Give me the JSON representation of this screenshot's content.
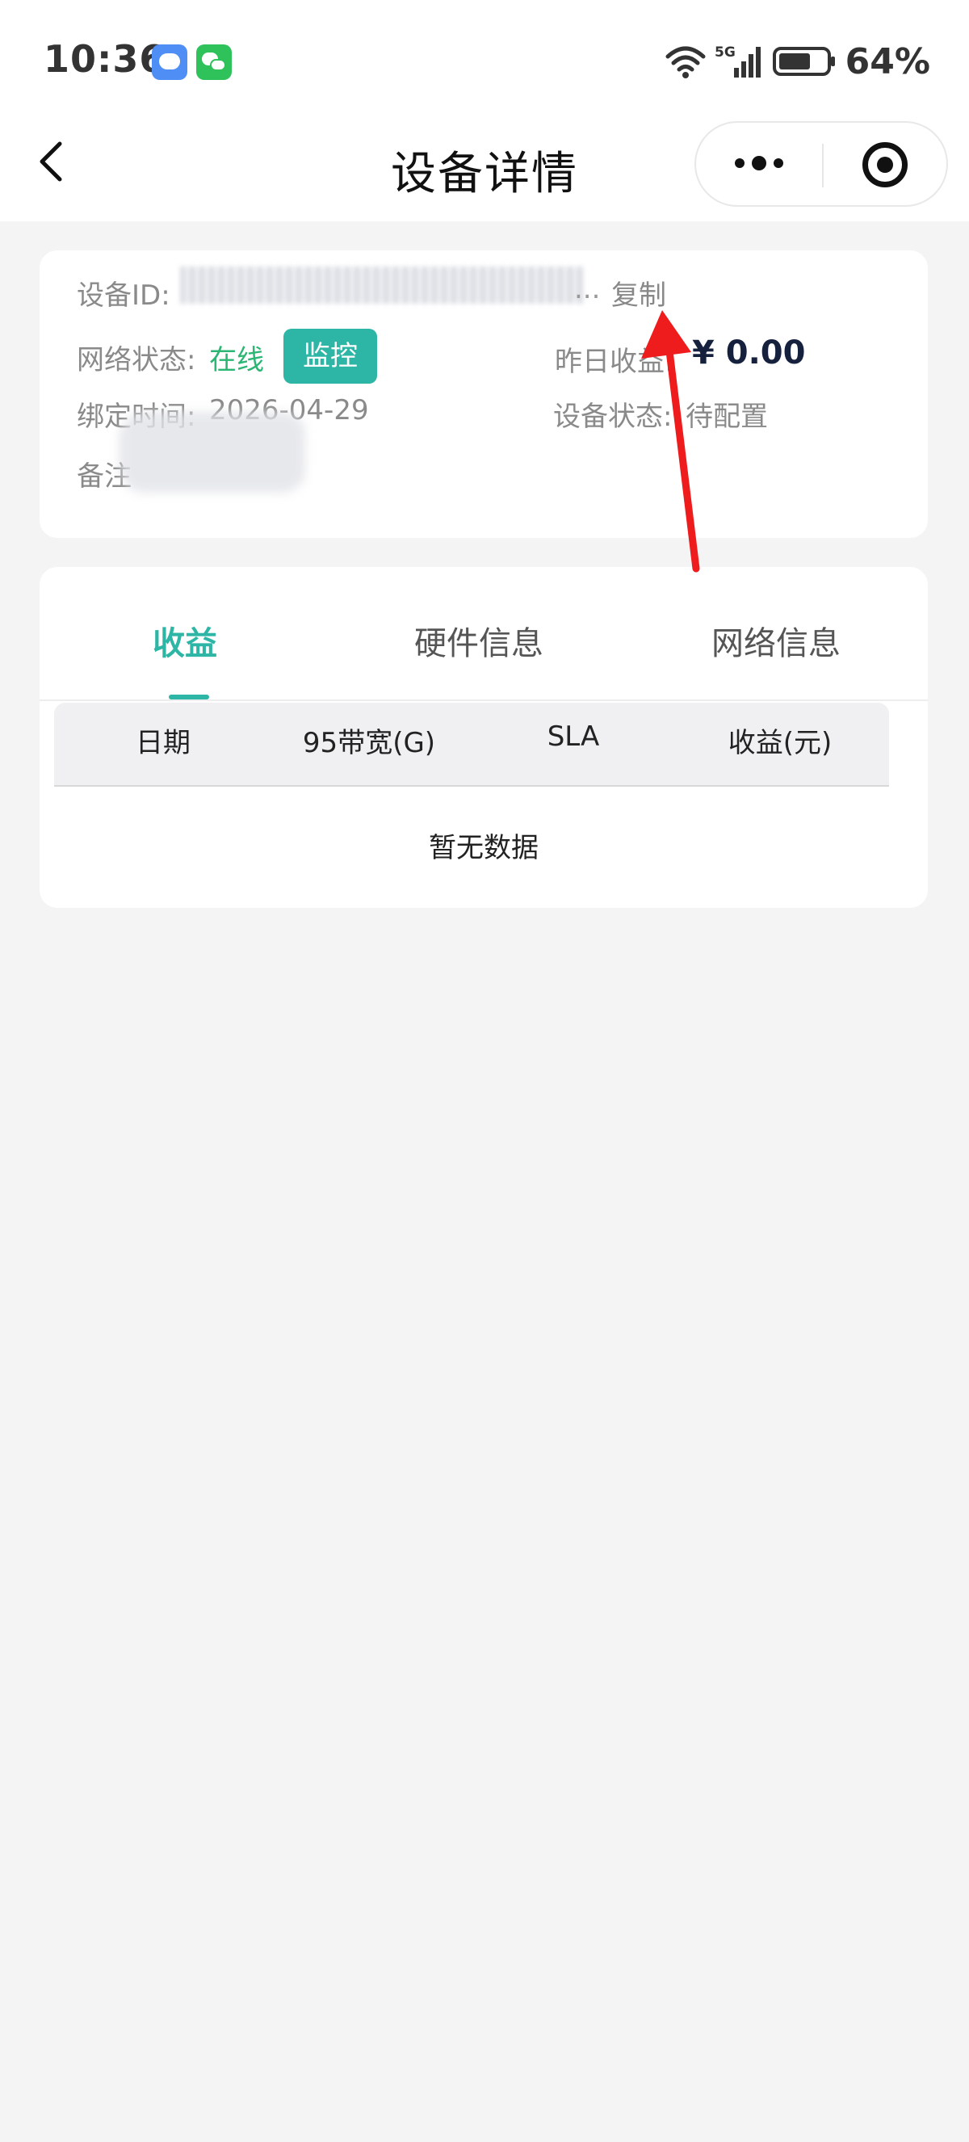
{
  "status_bar": {
    "time": "10:36",
    "network": "5G",
    "battery": "64%",
    "icons": [
      "message-app-icon",
      "wechat-icon",
      "wifi-icon",
      "signal-icon",
      "battery-icon"
    ]
  },
  "nav": {
    "title": "设备详情",
    "back_icon": "chevron-left-icon",
    "more_icon": "more-dots-icon",
    "close_icon": "target-circle-icon"
  },
  "device_info": {
    "id_label": "设备ID:",
    "id_ellipsis": "...",
    "copy_label": "复制",
    "network_status_label": "网络状态:",
    "network_status_value": "在线",
    "monitor_label": "监控",
    "yesterday_income_label": "昨日收益:",
    "yesterday_income_value": "¥ 0.00",
    "bind_time_label": "绑定时间:",
    "bind_time_value": "2026-04-29",
    "device_status_label": "设备状态:",
    "device_status_value": "待配置",
    "remark_label": "备注"
  },
  "tabs": [
    {
      "label": "收益",
      "active": true
    },
    {
      "label": "硬件信息",
      "active": false
    },
    {
      "label": "网络信息",
      "active": false
    }
  ],
  "table": {
    "columns": [
      "日期",
      "95带宽(G)",
      "SLA",
      "收益(元)"
    ],
    "empty_text": "暂无数据"
  },
  "colors": {
    "accent": "#2db5a5",
    "online": "#2bb673",
    "annotation": "#ee1c1c",
    "background": "#f4f4f4"
  }
}
